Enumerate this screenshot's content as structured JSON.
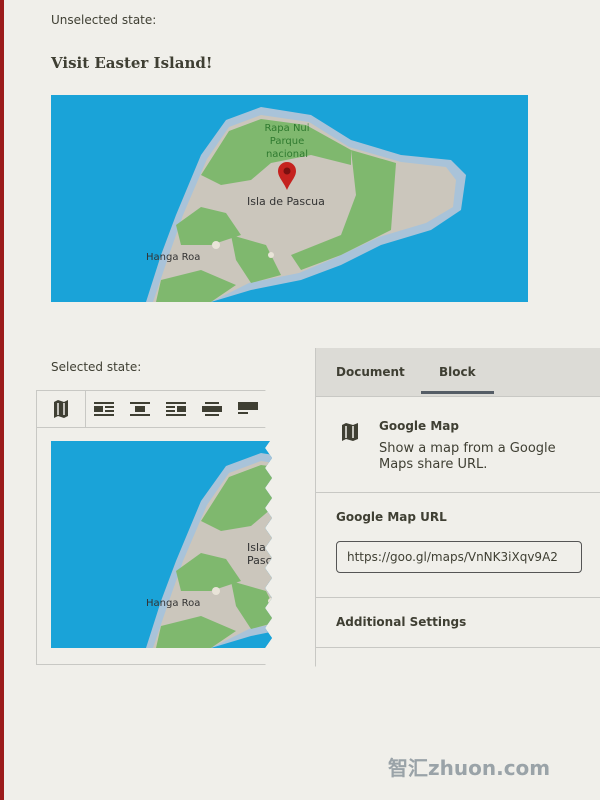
{
  "labels": {
    "unselected": "Unselected state:",
    "selected": "Selected state:"
  },
  "block_title": "Visit Easter Island!",
  "map": {
    "park_lines": [
      "Rapa Nui",
      "Parque",
      "nacional"
    ],
    "town": "Isla de Pascua",
    "city": "Hanga Roa",
    "marker_icon": "map-pin-icon",
    "water_color": "#1aa3d8",
    "land_color": "#cbc6bc",
    "park_color": "#7fb86e"
  },
  "toolbar": {
    "items": [
      {
        "icon": "map-icon"
      },
      {
        "icon": "align-left-icon"
      },
      {
        "icon": "align-center-icon"
      },
      {
        "icon": "align-right-icon"
      },
      {
        "icon": "align-wide-icon"
      },
      {
        "icon": "align-full-icon"
      }
    ]
  },
  "sidebar": {
    "tabs": [
      "Document",
      "Block"
    ],
    "active_tab": "Block",
    "block_name": "Google Map",
    "block_desc": "Show a map from a Google Maps share URL.",
    "url_label": "Google Map URL",
    "url_value": "https://goo.gl/maps/VnNK3iXqv9A2",
    "additional": "Additional Settings"
  },
  "watermark": "智汇zhuon.com"
}
